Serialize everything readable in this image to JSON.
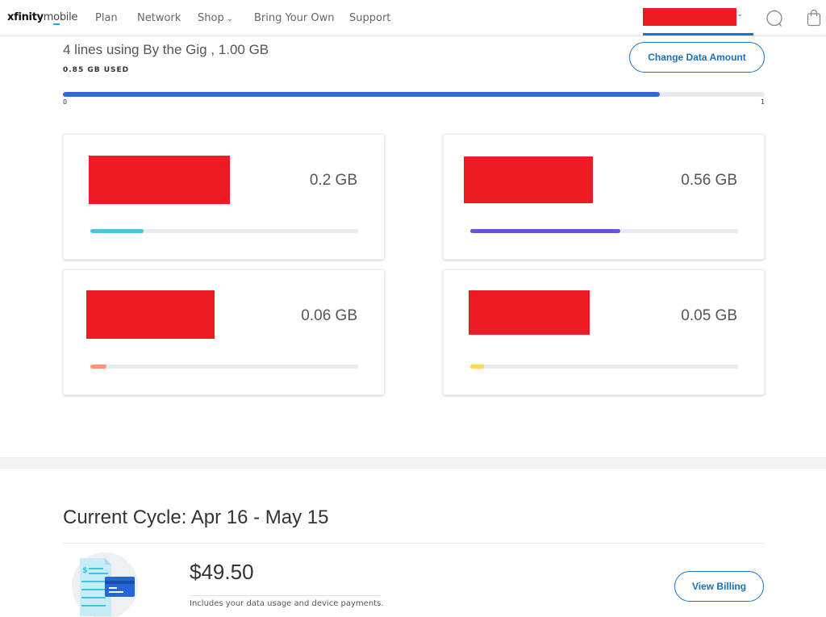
{
  "nav": {
    "logo_bold": "xfinity",
    "logo_light_1": "m",
    "logo_o": "o",
    "logo_light_2": "bile",
    "items": [
      {
        "label": "Plan"
      },
      {
        "label": "Network"
      },
      {
        "label": "Shop",
        "has_dropdown": true
      },
      {
        "label": "Bring Your Own"
      },
      {
        "label": "Support"
      }
    ],
    "account_name": "[redacted]",
    "icons": [
      "chevron-down-icon",
      "chat-icon",
      "shopping-bag-icon"
    ]
  },
  "plan": {
    "title": "4 lines using By the Gig , 1.00 GB",
    "used_label": "0.85 GB USED",
    "used_value": 0.85,
    "total_value": 1.0,
    "tick_min": "0",
    "tick_max": "1",
    "change_button": "Change Data Amount",
    "bar_color": "#2a6ae0"
  },
  "lines": [
    {
      "name": "[redacted]",
      "usage_label": "0.2 GB",
      "usage": 0.2,
      "color": "#4fc3d6"
    },
    {
      "name": "[redacted]",
      "usage_label": "0.56 GB",
      "usage": 0.56,
      "color": "#6a52d0"
    },
    {
      "name": "[redacted]",
      "usage_label": "0.06 GB",
      "usage": 0.06,
      "color": "#ff9473"
    },
    {
      "name": "[redacted]",
      "usage_label": "0.05 GB",
      "usage": 0.05,
      "color": "#ffd55a"
    }
  ],
  "cycle": {
    "title": "Current Cycle: Apr 16 - May 15",
    "amount": "$49.50",
    "note": "Includes your data usage and device payments.",
    "view_billing": "View Billing",
    "icon": "bill-document-card-icon"
  }
}
